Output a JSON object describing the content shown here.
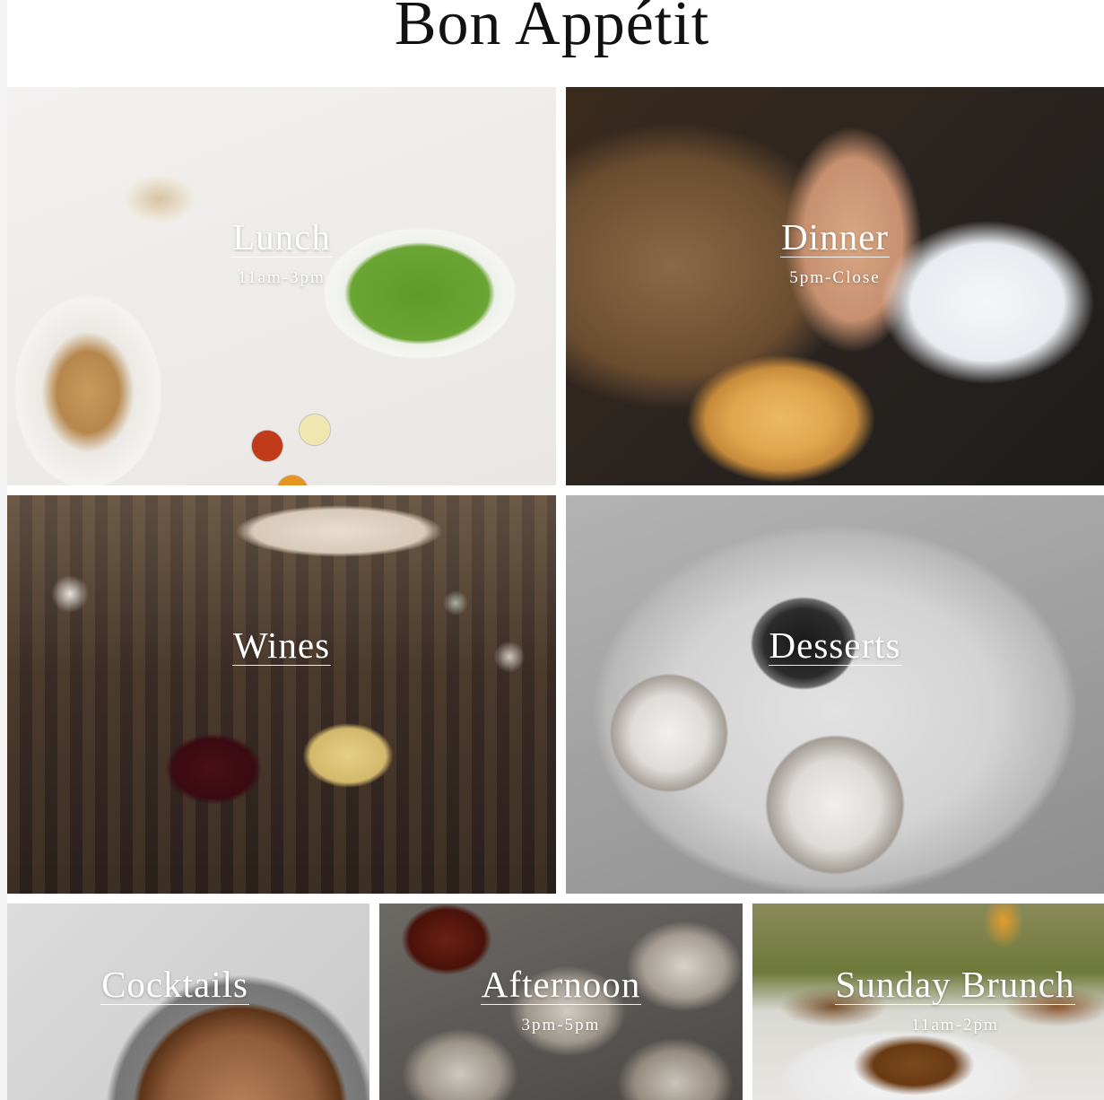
{
  "page": {
    "title": "Bon Appétit"
  },
  "tiles": [
    {
      "label": "Lunch",
      "hours": "11am-3pm"
    },
    {
      "label": "Dinner",
      "hours": "5pm-Close"
    },
    {
      "label": "Wines",
      "hours": ""
    },
    {
      "label": "Desserts",
      "hours": ""
    },
    {
      "label": "Cocktails",
      "hours": ""
    },
    {
      "label": "Afternoon",
      "hours": "3pm-5pm"
    },
    {
      "label": "Sunday Brunch",
      "hours": "11am-2pm"
    }
  ]
}
